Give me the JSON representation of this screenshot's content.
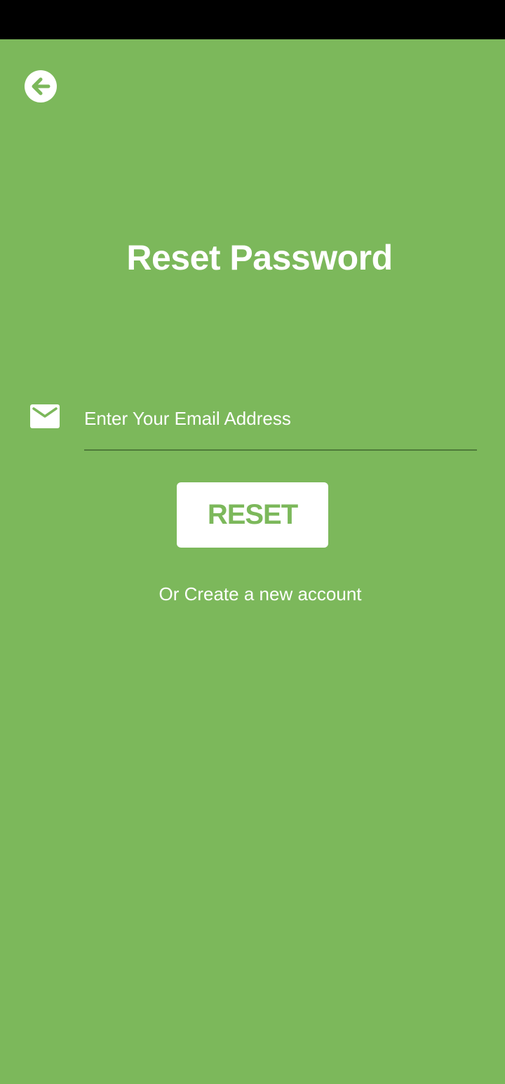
{
  "colors": {
    "background": "#7cb85b",
    "status_bar": "#000000",
    "text": "#ffffff",
    "button_background": "#ffffff",
    "button_text": "#7cb85b",
    "underline": "#4f7a3a"
  },
  "header": {
    "back_icon": "arrow-left-circle-icon"
  },
  "title": "Reset Password",
  "email": {
    "icon": "mail-icon",
    "value": "",
    "placeholder": "Enter Your Email Address"
  },
  "reset_button": {
    "label": "RESET"
  },
  "create_account": {
    "label": "Or Create a new account"
  }
}
